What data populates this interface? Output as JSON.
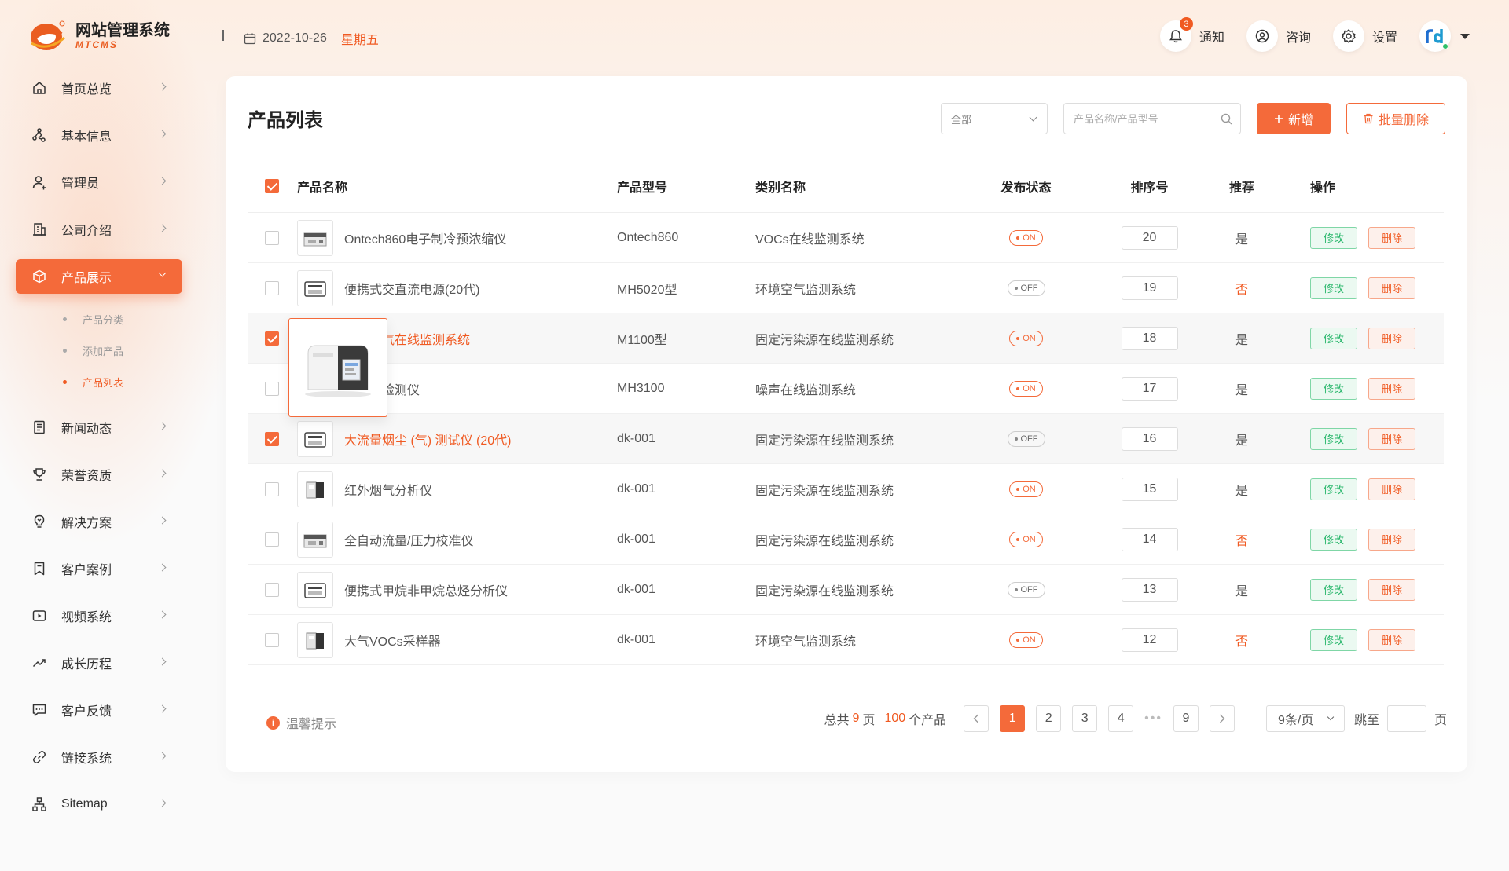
{
  "app": {
    "title": "网站管理系统",
    "subtitle": "MTCMS",
    "brand_color": "#f46a3a"
  },
  "header": {
    "date": "2022-10-26",
    "weekday": "星期五",
    "notify_label": "通知",
    "notify_count": "3",
    "consult_label": "咨询",
    "settings_label": "设置"
  },
  "sidebar": {
    "items": [
      {
        "label": "首页总览",
        "icon": "home-icon"
      },
      {
        "label": "基本信息",
        "icon": "share-icon"
      },
      {
        "label": "管理员",
        "icon": "user-icon"
      },
      {
        "label": "公司介绍",
        "icon": "building-icon"
      },
      {
        "label": "产品展示",
        "icon": "box-icon",
        "active": true
      },
      {
        "label": "新闻动态",
        "icon": "news-icon"
      },
      {
        "label": "荣誉资质",
        "icon": "trophy-icon"
      },
      {
        "label": "解决方案",
        "icon": "lightbulb-icon"
      },
      {
        "label": "客户案例",
        "icon": "bookmark-icon"
      },
      {
        "label": "视频系统",
        "icon": "video-icon"
      },
      {
        "label": "成长历程",
        "icon": "trend-icon"
      },
      {
        "label": "客户反馈",
        "icon": "chat-icon"
      },
      {
        "label": "链接系统",
        "icon": "link-icon"
      },
      {
        "label": "Sitemap",
        "icon": "sitemap-icon"
      }
    ],
    "subitems": [
      {
        "label": "产品分类"
      },
      {
        "label": "添加产品"
      },
      {
        "label": "产品列表",
        "active": true
      }
    ]
  },
  "main": {
    "title": "产品列表",
    "filter_value": "全部",
    "search_placeholder": "产品名称/产品型号",
    "add_label": "新增",
    "batch_delete_label": "批量删除",
    "columns": [
      "产品名称",
      "产品型号",
      "类别名称",
      "发布状态",
      "排序号",
      "推荐",
      "操作"
    ],
    "edit_label": "修改",
    "delete_label": "删除",
    "rows": [
      {
        "name": "Ontech860电子制冷预浓缩仪",
        "model": "Ontech860",
        "category": "VOCs在线监测系统",
        "status": "ON",
        "sort": "20",
        "recommend": "是",
        "checked": false,
        "highlight": false
      },
      {
        "name": "便携式交直流电源(20代)",
        "model": "MH5020型",
        "category": "环境空气监测系统",
        "status": "OFF",
        "sort": "19",
        "recommend": "否",
        "checked": false,
        "highlight": false
      },
      {
        "name": "烟尘烟气在线监测系统",
        "model": "M1100型",
        "category": "固定污染源在线监测系统",
        "status": "ON",
        "sort": "18",
        "recommend": "是",
        "checked": true,
        "highlight": true
      },
      {
        "name": "烟快速检测仪",
        "model": "MH3100",
        "category": "噪声在线监测系统",
        "status": "ON",
        "sort": "17",
        "recommend": "是",
        "checked": false,
        "highlight": false
      },
      {
        "name": "大流量烟尘 (气) 测试仪 (20代)",
        "model": "dk-001",
        "category": "固定污染源在线监测系统",
        "status": "OFF",
        "sort": "16",
        "recommend": "是",
        "checked": true,
        "highlight": true
      },
      {
        "name": "红外烟气分析仪",
        "model": "dk-001",
        "category": "固定污染源在线监测系统",
        "status": "ON",
        "sort": "15",
        "recommend": "是",
        "checked": false,
        "highlight": false
      },
      {
        "name": "全自动流量/压力校准仪",
        "model": "dk-001",
        "category": "固定污染源在线监测系统",
        "status": "ON",
        "sort": "14",
        "recommend": "否",
        "checked": false,
        "highlight": false
      },
      {
        "name": "便携式甲烷非甲烷总烃分析仪",
        "model": "dk-001",
        "category": "固定污染源在线监测系统",
        "status": "OFF",
        "sort": "13",
        "recommend": "是",
        "checked": false,
        "highlight": false
      },
      {
        "name": "大气VOCs采样器",
        "model": "dk-001",
        "category": "环境空气监测系统",
        "status": "ON",
        "sort": "12",
        "recommend": "否",
        "checked": false,
        "highlight": false
      }
    ]
  },
  "footer": {
    "tips_label": "温馨提示",
    "total_prefix": "总共",
    "total_pages": "9",
    "pages_unit": "页",
    "total_items": "100",
    "items_unit": "个产品",
    "pages": [
      "1",
      "2",
      "3",
      "4",
      "9"
    ],
    "current_page": "1",
    "ellipsis": "•••",
    "per_page": "9条/页",
    "jump_label": "跳至",
    "jump_unit": "页"
  }
}
